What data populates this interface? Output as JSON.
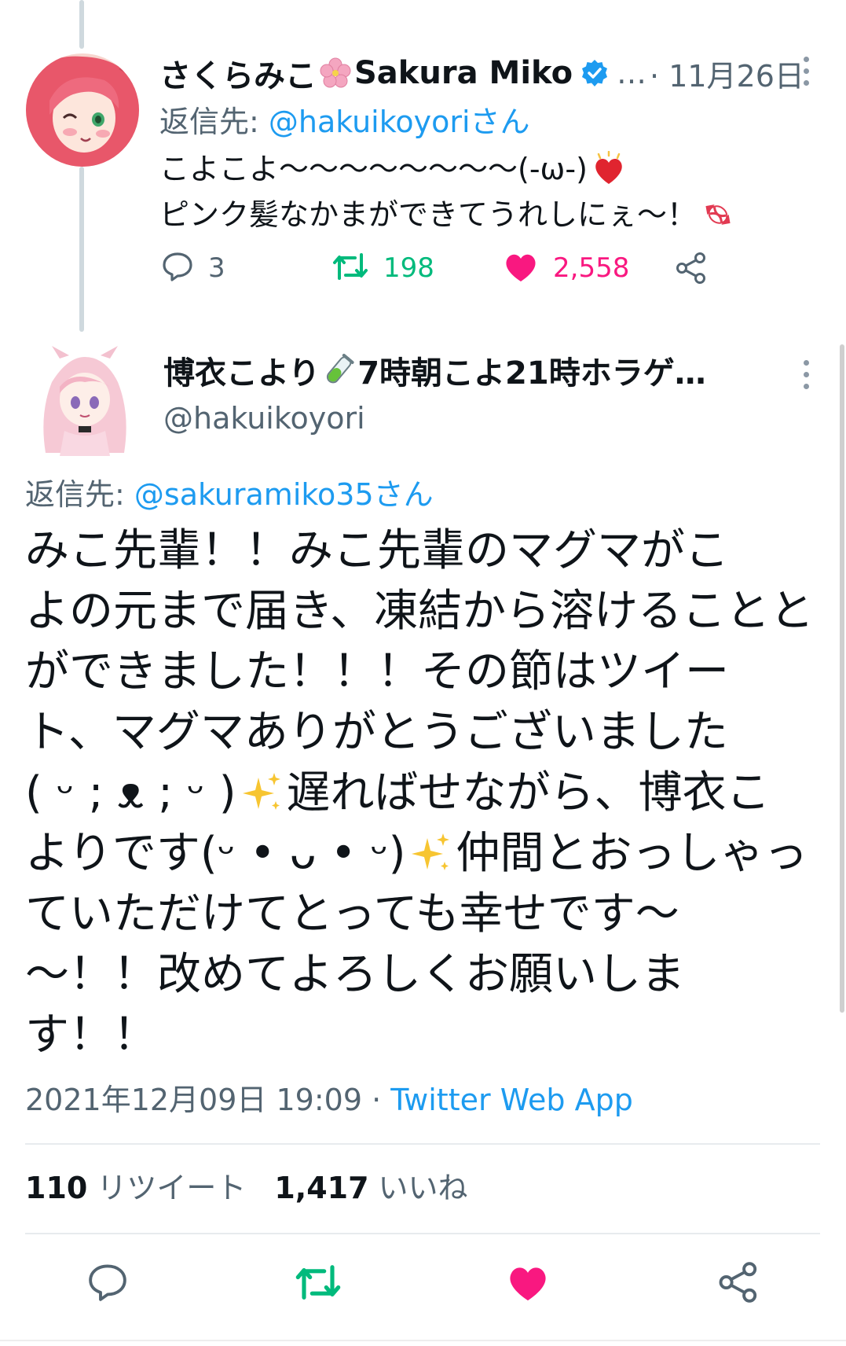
{
  "tweet1": {
    "display_name": "さくらみこ",
    "display_name_en": "Sakura Miko",
    "verified": true,
    "ellipsis": "…",
    "date": "· 11月26日",
    "reply_prefix": "返信先: ",
    "reply_handle": "@hakuikoyoriさん",
    "line1": "こよこよ〜〜〜〜〜〜〜〜(-ω-)",
    "line2": "ピンク髪なかまができてうれしにぇ〜！",
    "emojis": [
      "cherry-blossom",
      "sparkling-heart",
      "candy"
    ],
    "replies": "3",
    "retweets": "198",
    "likes": "2,558"
  },
  "tweet2": {
    "display_name": "博衣こより",
    "display_name_suffix": "7時朝こよ21時ホラゲ…",
    "handle": "@hakuikoyori",
    "reply_prefix": "返信先: ",
    "reply_handle": "@sakuramiko35さん",
    "text_lines": [
      "みこ先輩！！みこ先輩のマグマがこ",
      "よの元まで届き、凍結から溶けることと",
      "ができました！！！その節はツイー",
      "ト、マグマありがとうございました",
      "( ᵕ ; ᴥ ; ᵕ )",
      "遅ればせながら、博衣こ",
      "よりです(ᵕ • ᴗ • ᵕ)",
      "仲間とおっしゃっ",
      "ていただけてとっても幸せです〜",
      "〜！！改めてよろしくお願いしま",
      "す！！"
    ],
    "timestamp": "2021年12月09日 19:09 · ",
    "source": "Twitter Web App",
    "retweet_count": "110",
    "retweet_label": "リツイート",
    "like_count": "1,417",
    "like_label": "いいね",
    "emojis": [
      "test-tube",
      "sparkles"
    ]
  },
  "colors": {
    "accent": "#1d9bf0",
    "retweet_green": "#00ba7c",
    "like_pink": "#f91880",
    "secondary_text": "#536471"
  }
}
